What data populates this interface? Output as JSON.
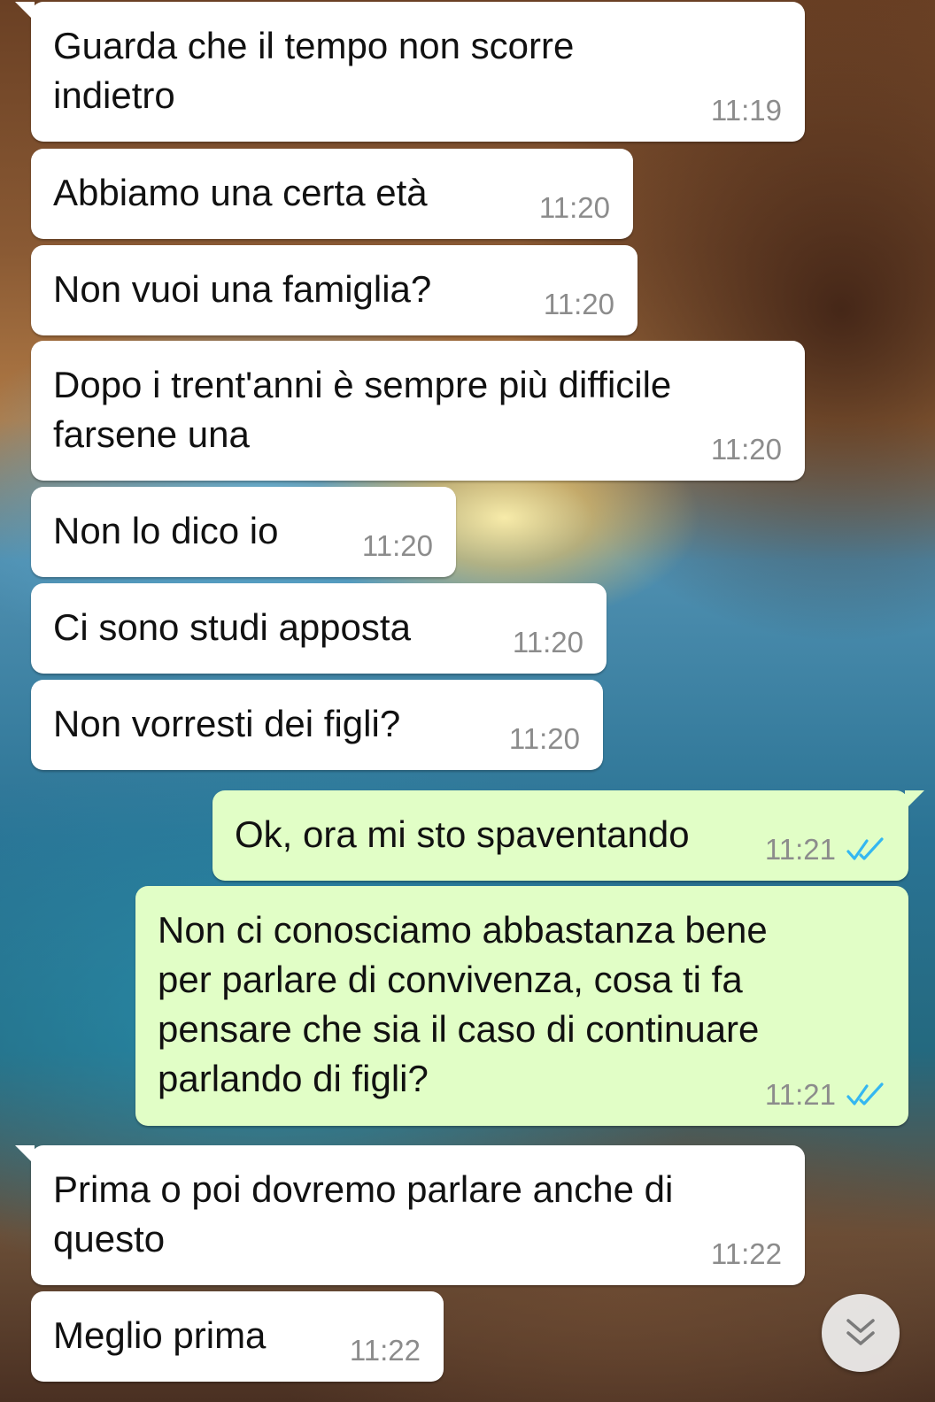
{
  "messages": [
    {
      "text": "Guarda che il tempo non scorre\nindietro",
      "time": "11:19"
    },
    {
      "text": "Abbiamo una certa età",
      "time": "11:20"
    },
    {
      "text": "Non vuoi una famiglia?",
      "time": "11:20"
    },
    {
      "text": "Dopo i trent'anni è sempre più difficile\nfarsene una",
      "time": "11:20"
    },
    {
      "text": "Non lo dico io",
      "time": "11:20"
    },
    {
      "text": "Ci sono studi apposta",
      "time": "11:20"
    },
    {
      "text": "Non vorresti dei figli?",
      "time": "11:20"
    },
    {
      "text": "Ok, ora mi sto spaventando",
      "time": "11:21",
      "status": "read"
    },
    {
      "text": "Non ci conosciamo abbastanza bene\nper parlare di convivenza, cosa ti fa\npensare che sia il caso di continuare\nparlando di figli?",
      "time": "11:21",
      "status": "read"
    },
    {
      "text": "Prima o poi dovremo parlare anche di\nquesto",
      "time": "11:22"
    },
    {
      "text": "Meglio prima",
      "time": "11:22"
    }
  ],
  "icons": {
    "read_receipt": "double-check-icon",
    "scroll_down": "double-chevron-down-icon"
  },
  "colors": {
    "incoming_bubble": "#ffffff",
    "outgoing_bubble": "#e1fec6",
    "read_ticks": "#34b7f1",
    "timestamp": "#8c8c8c"
  }
}
